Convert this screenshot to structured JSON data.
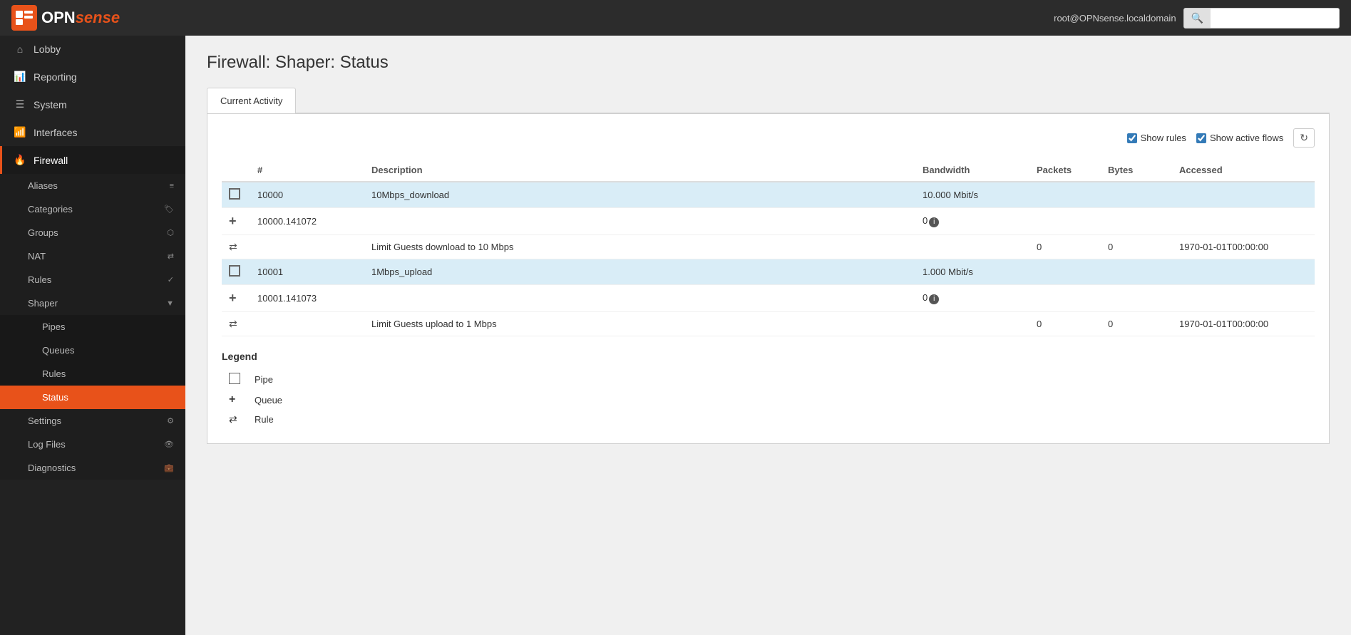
{
  "header": {
    "user": "root@OPNsense.localdomain",
    "search_placeholder": ""
  },
  "logo": {
    "text_opn": "OPN",
    "text_sense": "sense"
  },
  "sidebar": {
    "items": [
      {
        "id": "lobby",
        "label": "Lobby",
        "icon": "⌂"
      },
      {
        "id": "reporting",
        "label": "Reporting",
        "icon": "📊"
      },
      {
        "id": "system",
        "label": "System",
        "icon": "☰"
      },
      {
        "id": "interfaces",
        "label": "Interfaces",
        "icon": "📶"
      },
      {
        "id": "firewall",
        "label": "Firewall",
        "icon": "🔥",
        "active": true
      }
    ],
    "sub_items": [
      {
        "id": "aliases",
        "label": "Aliases",
        "badge": "≡"
      },
      {
        "id": "categories",
        "label": "Categories",
        "badge": "🏷"
      },
      {
        "id": "groups",
        "label": "Groups",
        "badge": "⬡"
      },
      {
        "id": "nat",
        "label": "NAT",
        "badge": "⇄"
      },
      {
        "id": "rules",
        "label": "Rules",
        "badge": "✓"
      },
      {
        "id": "shaper",
        "label": "Shaper",
        "badge": "⬡"
      }
    ],
    "shaper_sub": [
      {
        "id": "pipes",
        "label": "Pipes"
      },
      {
        "id": "queues",
        "label": "Queues"
      },
      {
        "id": "rules",
        "label": "Rules"
      },
      {
        "id": "status",
        "label": "Status",
        "active": true
      }
    ],
    "bottom_items": [
      {
        "id": "settings",
        "label": "Settings",
        "badge": "⚙"
      },
      {
        "id": "logfiles",
        "label": "Log Files",
        "badge": "👁"
      },
      {
        "id": "diagnostics",
        "label": "Diagnostics",
        "badge": "💼"
      }
    ]
  },
  "page": {
    "title": "Firewall: Shaper: Status"
  },
  "tabs": [
    {
      "id": "current-activity",
      "label": "Current Activity",
      "active": true
    }
  ],
  "options": {
    "show_rules_label": "Show rules",
    "show_rules_checked": true,
    "show_active_flows_label": "Show active flows",
    "show_active_flows_checked": true,
    "refresh_icon": "↻"
  },
  "table": {
    "columns": [
      "#",
      "Description",
      "Bandwidth",
      "Packets",
      "Bytes",
      "Accessed"
    ],
    "rows": [
      {
        "type": "pipe",
        "highlight": true,
        "hash": "10000",
        "description": "10Mbps_download",
        "bandwidth": "10.000 Mbit/s",
        "packets": "",
        "bytes": "",
        "accessed": ""
      },
      {
        "type": "queue",
        "highlight": false,
        "hash": "10000.141072",
        "description": "",
        "bandwidth": "0",
        "bandwidth_info": true,
        "packets": "",
        "bytes": "",
        "accessed": ""
      },
      {
        "type": "rule",
        "highlight": false,
        "hash": "",
        "description": "Limit Guests download to 10 Mbps",
        "bandwidth": "",
        "packets": "0",
        "bytes": "0",
        "accessed": "1970-01-01T00:00:00"
      },
      {
        "type": "pipe",
        "highlight": true,
        "hash": "10001",
        "description": "1Mbps_upload",
        "bandwidth": "1.000 Mbit/s",
        "packets": "",
        "bytes": "",
        "accessed": ""
      },
      {
        "type": "queue",
        "highlight": false,
        "hash": "10001.141073",
        "description": "",
        "bandwidth": "0",
        "bandwidth_info": true,
        "packets": "",
        "bytes": "",
        "accessed": ""
      },
      {
        "type": "rule",
        "highlight": false,
        "hash": "",
        "description": "Limit Guests upload to 1 Mbps",
        "bandwidth": "",
        "packets": "0",
        "bytes": "0",
        "accessed": "1970-01-01T00:00:00"
      }
    ]
  },
  "legend": {
    "title": "Legend",
    "items": [
      {
        "type": "pipe",
        "label": "Pipe"
      },
      {
        "type": "queue",
        "label": "Queue"
      },
      {
        "type": "rule",
        "label": "Rule"
      }
    ]
  }
}
